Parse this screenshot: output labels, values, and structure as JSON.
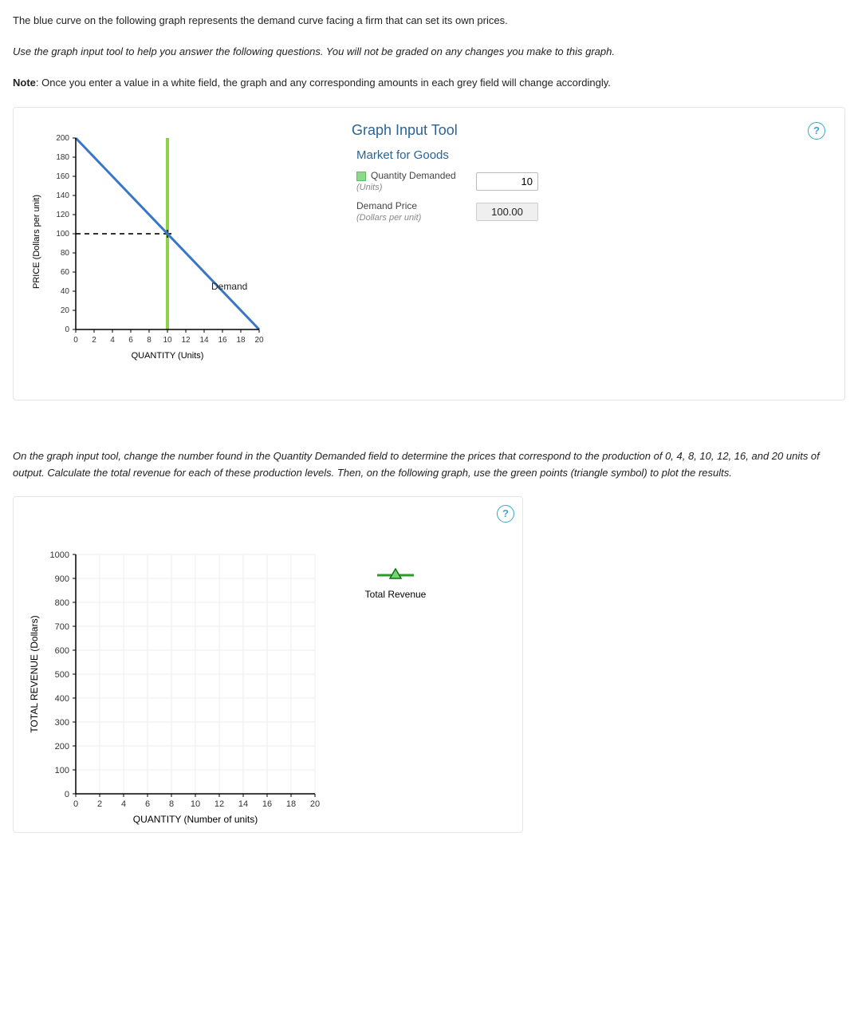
{
  "intro": {
    "p1": "The blue curve on the following graph represents the demand curve facing a firm that can set its own prices.",
    "p2_italic": "Use the graph input tool to help you answer the following questions. You will not be graded on any changes you make to this graph.",
    "p3_prefix_bold": "Note",
    "p3_rest": ": Once you enter a value in a white field, the graph and any corresponding amounts in each grey field will change accordingly."
  },
  "tool": {
    "title": "Graph Input Tool",
    "section": "Market for Goods",
    "help": "?",
    "qty_label": "Quantity Demanded",
    "qty_sub": "(Units)",
    "qty_value": "10",
    "price_label": "Demand Price",
    "price_sub": "(Dollars per unit)",
    "price_value": "100.00"
  },
  "graph1": {
    "ylabel": "PRICE (Dollars per unit)",
    "xlabel": "QUANTITY (Units)",
    "y_ticks": [
      "0",
      "20",
      "40",
      "60",
      "80",
      "100",
      "120",
      "140",
      "160",
      "180",
      "200"
    ],
    "x_ticks": [
      "0",
      "2",
      "4",
      "6",
      "8",
      "10",
      "12",
      "14",
      "16",
      "18",
      "20"
    ],
    "demand_label": "Demand"
  },
  "mid_instruction": "On the graph input tool, change the number found in the Quantity Demanded field to determine the prices that correspond to the production of 0, 4, 8, 10, 12, 16, and 20 units of output. Calculate the total revenue for each of these production levels. Then, on the following graph, use the green points (triangle symbol) to plot the results.",
  "graph2": {
    "ylabel": "TOTAL REVENUE (Dollars)",
    "xlabel": "QUANTITY (Number of units)",
    "y_ticks": [
      "0",
      "100",
      "200",
      "300",
      "400",
      "500",
      "600",
      "700",
      "800",
      "900",
      "1000"
    ],
    "x_ticks": [
      "0",
      "2",
      "4",
      "6",
      "8",
      "10",
      "12",
      "14",
      "16",
      "18",
      "20"
    ],
    "legend": "Total Revenue",
    "help": "?"
  },
  "chart_data": [
    {
      "type": "line",
      "title": "Demand curve with indicator",
      "xlabel": "QUANTITY (Units)",
      "ylabel": "PRICE (Dollars per unit)",
      "xlim": [
        0,
        20
      ],
      "ylim": [
        0,
        200
      ],
      "series": [
        {
          "name": "Demand",
          "x": [
            0,
            20
          ],
          "y": [
            200,
            0
          ]
        }
      ],
      "indicator": {
        "quantity": 10,
        "price": 100
      },
      "annotations": [
        "Demand"
      ]
    },
    {
      "type": "scatter",
      "title": "Total Revenue plotting grid (empty)",
      "xlabel": "QUANTITY (Number of units)",
      "ylabel": "TOTAL REVENUE (Dollars)",
      "xlim": [
        0,
        20
      ],
      "ylim": [
        0,
        1000
      ],
      "series": [
        {
          "name": "Total Revenue",
          "x": [],
          "y": []
        }
      ],
      "legend_position": "right"
    }
  ]
}
